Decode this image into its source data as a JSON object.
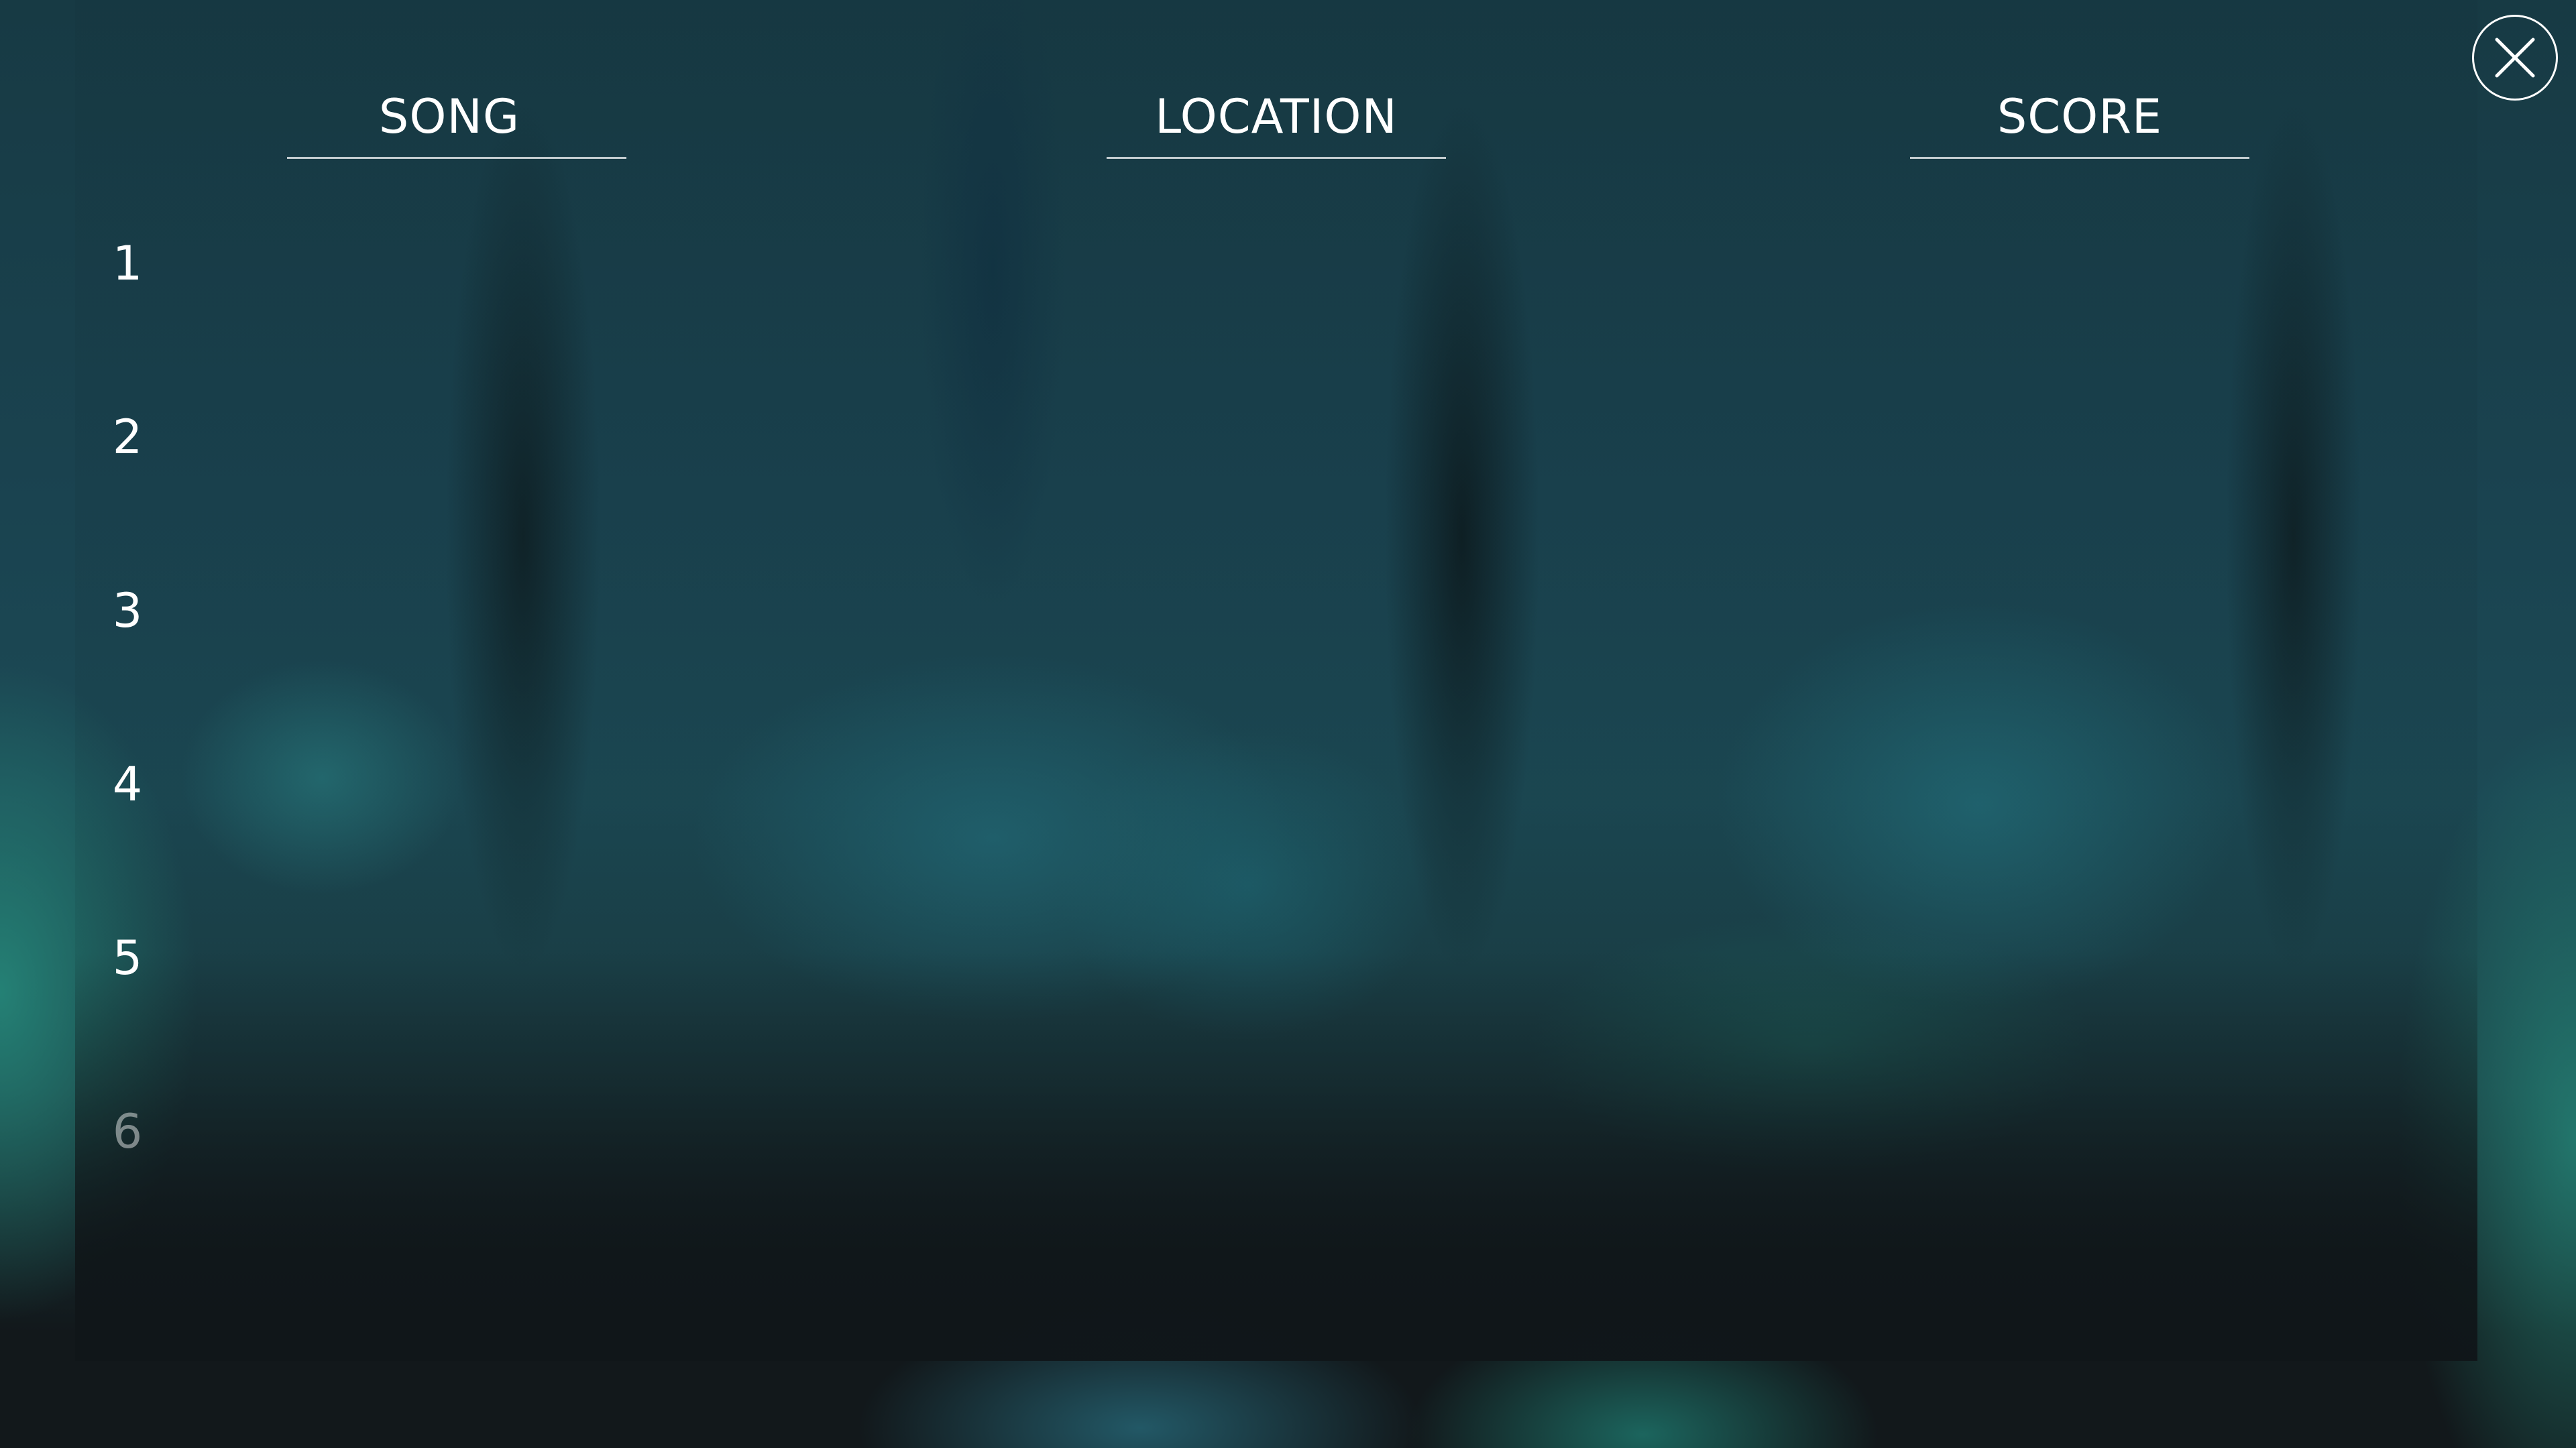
{
  "leaderboard": {
    "columns": {
      "song": "SONG",
      "location": "LOCATION",
      "score": "SCORE"
    },
    "ranks": [
      "1",
      "2",
      "3",
      "4",
      "5",
      "6"
    ]
  },
  "icons": {
    "close": "close-icon"
  }
}
